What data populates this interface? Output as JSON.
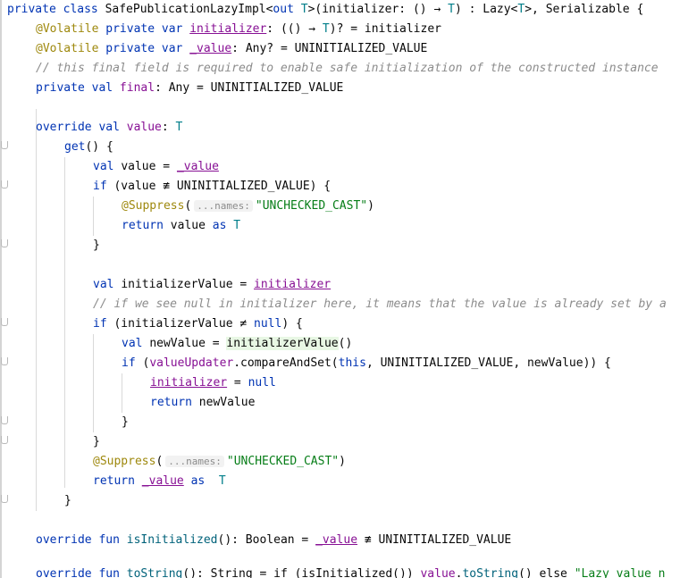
{
  "code": {
    "l1": {
      "a": "private class ",
      "b": "SafePublicationLazyImpl",
      "c": "<",
      "d": "out ",
      "e": "T",
      "f": ">(initializer: () ",
      "g": "→",
      "h": " ",
      "i": "T",
      "j": ") : Lazy<",
      "k": "T",
      "l": ">, Serializable {"
    },
    "l2": {
      "a": "@Volatile",
      "b": " private var ",
      "c": "initializer",
      "d": ": (() ",
      "e": "→",
      "f": " ",
      "g": "T",
      "h": ")? = initializer"
    },
    "l3": {
      "a": "@Volatile",
      "b": " private var ",
      "c": "_value",
      "d": ": Any? = UNINITIALIZED_VALUE"
    },
    "l4": {
      "a": "// this final field is required to enable safe initialization of the constructed instance"
    },
    "l5": {
      "a": "private val ",
      "b": "final",
      "c": ": Any = UNINITIALIZED_VALUE"
    },
    "l7": {
      "a": "override val ",
      "b": "value",
      "c": ": ",
      "d": "T"
    },
    "l8": {
      "a": "get",
      "b": "() {"
    },
    "l9": {
      "a": "val ",
      "b": "value = ",
      "c": "_value"
    },
    "l10": {
      "a": "if ",
      "b": "(value ",
      "c": "≢",
      "d": " UNINITIALIZED_VALUE) {"
    },
    "l11": {
      "a": "@Suppress",
      "b": "(",
      "c": "...names:",
      "d": "\"UNCHECKED_CAST\"",
      "e": ")"
    },
    "l12": {
      "a": "return ",
      "b": "value ",
      "c": "as ",
      "d": "T"
    },
    "l13": {
      "a": "}"
    },
    "l15": {
      "a": "val ",
      "b": "initializerValue = ",
      "c": "initializer"
    },
    "l16": {
      "a": "// if we see null in initializer here, it means that the value is already set by a"
    },
    "l17": {
      "a": "if ",
      "b": "(initializerValue ",
      "c": "≠",
      "d": " ",
      "e": "null",
      "f": ") {"
    },
    "l18": {
      "a": "val ",
      "b": "newValue = ",
      "c": "initializerValue",
      "d": "()"
    },
    "l19": {
      "a": "if ",
      "b": "(",
      "c": "valueUpdater",
      "d": ".compareAndSet(",
      "e": "this",
      "f": ", UNINITIALIZED_VALUE, newValue)) {"
    },
    "l20": {
      "a": "initializer",
      "b": " = ",
      "c": "null"
    },
    "l21": {
      "a": "return ",
      "b": "newValue"
    },
    "l22": {
      "a": "}"
    },
    "l23": {
      "a": "}"
    },
    "l24": {
      "a": "@Suppress",
      "b": "(",
      "c": "...names:",
      "d": "\"UNCHECKED_CAST\"",
      "e": ")"
    },
    "l25": {
      "a": "return ",
      "b": "_value",
      "c": " as ",
      "d": "T"
    },
    "l26": {
      "a": "}"
    },
    "l28": {
      "a": "override fun ",
      "b": "isInitialized",
      "c": "(): Boolean = ",
      "d": "_value",
      "e": " ",
      "f": "≢",
      "g": " UNINITIALIZED_VALUE"
    },
    "l30": {
      "a": "override fun ",
      "b": "toString",
      "c": "(): String = if (isInitialized()) ",
      "d": "value",
      "e": ".",
      "f": "toString",
      "g": "() else ",
      "h": "\"Lazy value n"
    }
  },
  "colors": {
    "keyword": "#0033b3",
    "annotation": "#9e880d",
    "field": "#871094",
    "comment": "#8c8c8c",
    "string": "#067d17",
    "type_param": "#007e8a",
    "function": "#00627a",
    "highlight": "#e8f7e4"
  },
  "icons": [
    "fold-marker-icon"
  ]
}
